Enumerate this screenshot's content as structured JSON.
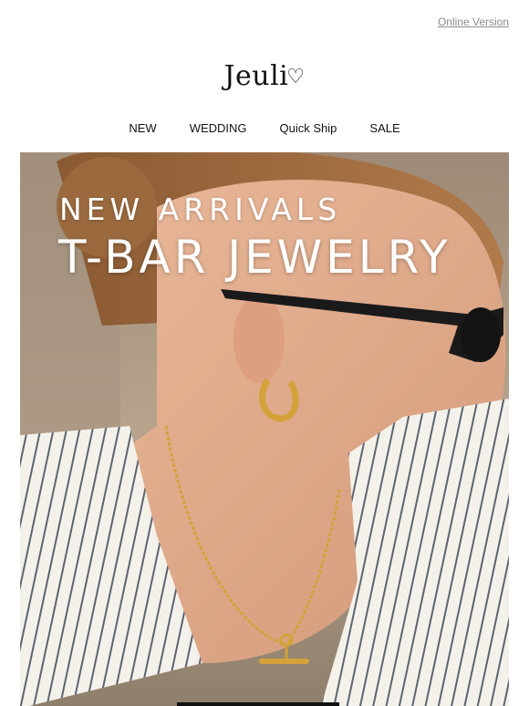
{
  "header": {
    "online_version": "Online Version",
    "logo_text": "Jeuli",
    "logo_mark": "heart-logo-icon"
  },
  "nav": {
    "items": [
      {
        "label": "NEW"
      },
      {
        "label": "WEDDING"
      },
      {
        "label": "Quick Ship"
      },
      {
        "label": "SALE"
      }
    ]
  },
  "hero": {
    "line1": "NEW ARRIVALS",
    "line2": "T-BAR JEWELRY"
  },
  "colors": {
    "text": "#111111",
    "muted_link": "#8a8a8a",
    "jewelry_gold": "#d4a23a"
  }
}
